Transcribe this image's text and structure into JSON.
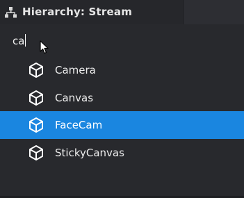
{
  "window": {
    "title": "Hierarchy: Stream",
    "icon": "hierarchy-icon"
  },
  "search": {
    "value": "ca",
    "placeholder": ""
  },
  "results": [
    {
      "label": "Camera",
      "icon": "cube-icon",
      "selected": false
    },
    {
      "label": "Canvas",
      "icon": "cube-icon",
      "selected": false
    },
    {
      "label": "FaceCam",
      "icon": "cube-icon",
      "selected": true
    },
    {
      "label": "StickyCanvas",
      "icon": "cube-icon",
      "selected": false
    }
  ],
  "colors": {
    "background": "#28292d",
    "tab_background": "#26272b",
    "selection": "#1a86e0",
    "text": "#ececec"
  }
}
